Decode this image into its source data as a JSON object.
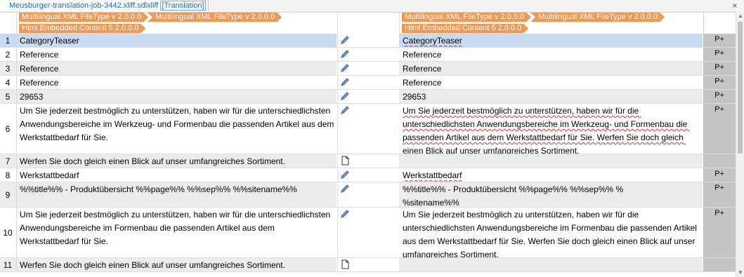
{
  "tab": {
    "filename": "Meusburger-translation-job-3442.xliff.sdlxliff",
    "view": "[Translation]"
  },
  "close_label": "×",
  "source_tags": [
    "Multilingual XML FileType v 2.0.0.0",
    "Multilingual XML FileType v 2.0.0.0",
    "Html Embedded Content 5 2.0.0.0"
  ],
  "target_tags": [
    "Multilingual XML FileType v 2.0.0.0",
    "Multilingual XML FileType v 2.0.0.0",
    "Html Embedded Content 5 2.0.0.0"
  ],
  "segments": [
    {
      "n": "1",
      "status": "edited",
      "source": "CategoryTeaser",
      "target": "CategoryTeaser",
      "match": "P+"
    },
    {
      "n": "2",
      "status": "edited",
      "source": "Reference",
      "target": "Reference",
      "match": "P+"
    },
    {
      "n": "3",
      "status": "edited",
      "source": "Reference",
      "target": "Reference",
      "match": "P+"
    },
    {
      "n": "4",
      "status": "edited",
      "source": "Reference",
      "target": "Reference",
      "match": "P+"
    },
    {
      "n": "5",
      "status": "edited",
      "source": "29653",
      "target": "29653",
      "match": "P+"
    },
    {
      "n": "6",
      "status": "edited",
      "source": "Um Sie jederzeit bestmöglich zu unterstützen, haben wir für die unterschiedlichsten Anwendungsbereiche im Werkzeug- und Formenbau die passenden Artikel aus dem Werkstattbedarf für Sie.",
      "target": "Um Sie jederzeit bestmöglich zu unterstützen, haben wir für die unterschiedlichsten Anwendungsbereiche im Werkzeug- und Formenbau die passenden Artikel aus dem Werkstattbedarf für Sie. Werfen Sie doch gleich einen Blick auf unser umfangreiches Sortiment.",
      "match": "P+"
    },
    {
      "n": "7",
      "status": "empty",
      "source": "Werfen Sie doch gleich einen Blick auf unser umfangreiches Sortiment.",
      "target": "",
      "match": ""
    },
    {
      "n": "8",
      "status": "edited",
      "source": "Werkstattbedarf",
      "target": "Werkstattbedarf",
      "match": "P+"
    },
    {
      "n": "9",
      "status": "edited",
      "source": "%%title%% - Produktübersicht %%page%% %%sep%% %%sitename%%",
      "target": "%%title%% - Produktübersicht %%page%% %%sep%% %\n%sitename%%",
      "match": "P+"
    },
    {
      "n": "10",
      "status": "edited",
      "source": "Um Sie jederzeit bestmöglich zu unterstützen, haben wir für die unterschiedlichsten Anwendungsbereiche im Formenbau die passenden Artikel aus dem Werkstattbedarf für Sie.",
      "target": "Um Sie jederzeit bestmöglich zu unterstützen, haben wir für die unterschiedlichsten Anwendungsbereiche im Formenbau die passenden Artikel aus dem Werkstattbedarf für Sie. Werfen Sie doch gleich einen Blick auf unser umfangreiches Sortiment.",
      "match": "P+"
    },
    {
      "n": "11",
      "status": "empty",
      "source": "Werfen Sie doch gleich einen Blick auf unser umfangreiches Sortiment.",
      "target": "",
      "match": ""
    }
  ],
  "colors": {
    "tag": "#ee9a55",
    "selection": "#c7daf0",
    "alt_row": "#ececec",
    "match_col": "#c4c4c4",
    "tab_text": "#1a6fb5"
  },
  "icons": {
    "edited": "pencil-icon",
    "empty": "document-icon"
  }
}
